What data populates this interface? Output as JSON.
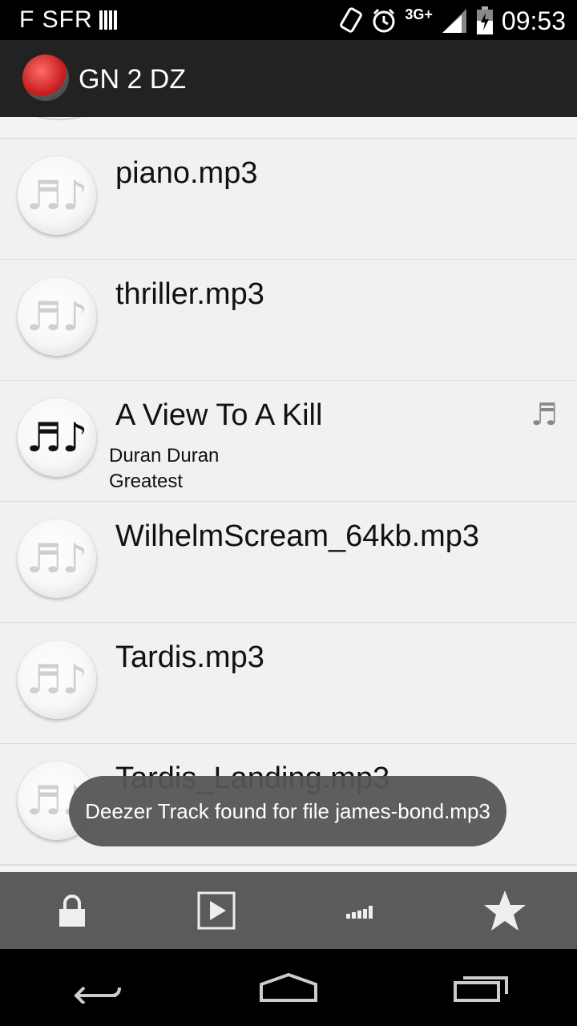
{
  "status": {
    "carrier": "F SFR",
    "network": "3G+",
    "time": "09:53",
    "icons": [
      "sim-icon",
      "vibrate-icon",
      "alarm-icon",
      "signal-icon",
      "battery-icon"
    ]
  },
  "app": {
    "title": "GN 2 DZ",
    "logo_icon": "app-logo-icon"
  },
  "tracks": [
    {
      "name": "piano.mp3",
      "artist": "",
      "album": "",
      "icon": "music-note-icon",
      "active": false
    },
    {
      "name": "thriller.mp3",
      "artist": "",
      "album": "",
      "icon": "music-note-icon",
      "active": false
    },
    {
      "name": "A View To A Kill",
      "artist": "Duran Duran",
      "album": "Greatest",
      "icon": "music-note-icon",
      "active": true,
      "badge_icon": "music-badge-icon"
    },
    {
      "name": "WilhelmScream_64kb.mp3",
      "artist": "",
      "album": "",
      "icon": "music-note-icon",
      "active": false
    },
    {
      "name": "Tardis.mp3",
      "artist": "",
      "album": "",
      "icon": "music-note-icon",
      "active": false
    },
    {
      "name": "Tardis_Landing.mp3",
      "artist": "",
      "album": "",
      "icon": "music-note-icon",
      "active": false
    }
  ],
  "toast": {
    "message": "Deezer Track found for file james-bond.mp3"
  },
  "bottom_bar": {
    "buttons": [
      "lock-icon",
      "play-icon",
      "equalizer-icon",
      "star-icon"
    ]
  },
  "nav_bar": {
    "buttons": [
      "back-icon",
      "home-icon",
      "recents-icon"
    ]
  }
}
